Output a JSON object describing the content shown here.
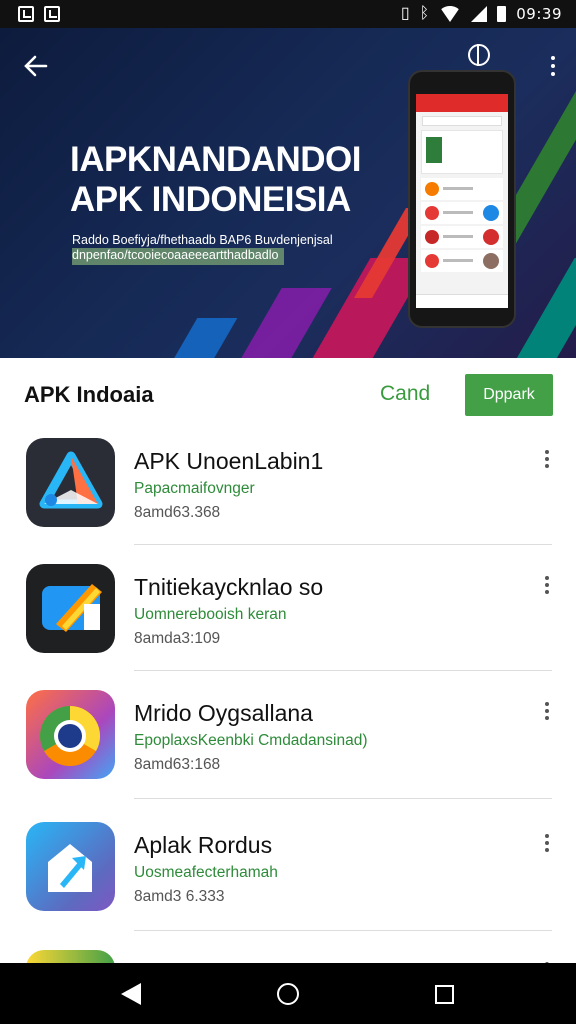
{
  "status_bar": {
    "time": "09:39"
  },
  "banner": {
    "title_line1": "IAPKNANDANDOI",
    "title_line2": "APK INDONEISIA",
    "subtitle_line1": "Raddo Boefiyja/fhethaadb BAP6 Buvdenjenjsal",
    "subtitle_line2": "dnpenfao/tcooiecoaaeeeartthadbadlo"
  },
  "header": {
    "title": "APK Indoaia",
    "cancel_label": "Cand",
    "open_label": "Dppark"
  },
  "apps": [
    {
      "name": "APK UnoenLabin1",
      "developer": "Papacmaifovnger",
      "meta": "8amd63.368",
      "icon": "delta-triangle-icon"
    },
    {
      "name": "Tnitiekaycknlao so",
      "developer": "Uomnerebooish keran",
      "meta": "8amda3:109",
      "icon": "pencil-note-icon"
    },
    {
      "name": "Mrido Oygsallana",
      "developer": "EpoplaxsKeenbki Cmdadansinad)",
      "meta": "8amd63:168",
      "icon": "chrome-browser-icon"
    },
    {
      "name": "Aplak Rordus",
      "developer": "Uosmeafecterhamah",
      "meta": "8amd3 6.333",
      "icon": "shopping-bag-arrow-icon"
    }
  ],
  "colors": {
    "accent_green": "#43a047",
    "link_green": "#2e8b3a",
    "banner_bg": "#13244b"
  }
}
